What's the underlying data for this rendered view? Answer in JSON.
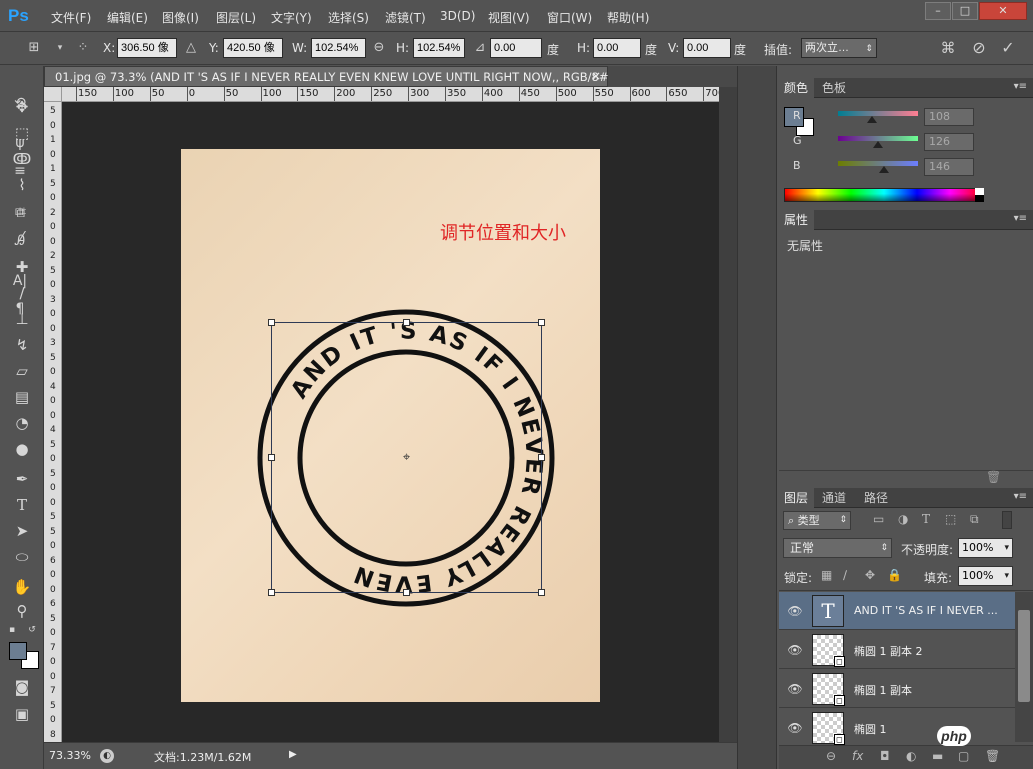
{
  "app": {
    "logo": "Ps"
  },
  "menu": [
    "文件(F)",
    "编辑(E)",
    "图像(I)",
    "图层(L)",
    "文字(Y)",
    "选择(S)",
    "滤镜(T)",
    "3D(D)",
    "视图(V)",
    "窗口(W)",
    "帮助(H)"
  ],
  "window_controls": {
    "minimize": "–",
    "maximize": "□",
    "close": "✕"
  },
  "options": {
    "x_label": "X:",
    "x_value": "306.50 像",
    "y_label": "Y:",
    "y_value": "420.50 像",
    "w_label": "W:",
    "w_value": "102.54%",
    "h_label": "H:",
    "h_value": "102.54%",
    "angle_value": "0.00",
    "angle_unit": "度",
    "hskew_label": "H:",
    "hskew_value": "0.00",
    "hskew_unit": "度",
    "vskew_label": "V:",
    "vskew_value": "0.00",
    "vskew_unit": "度",
    "interp_label": "插值:",
    "interp_value": "两次立…"
  },
  "document": {
    "tab_title": "01.jpg @ 73.3% (AND IT 'S  AS IF I NEVER REALLY EVEN KNEW LOVE UNTIL RIGHT NOW,, RGB/8#) *",
    "close": "×",
    "ruler_top_labels": [
      "150",
      "100",
      "50",
      "0",
      "50",
      "100",
      "150",
      "200",
      "250",
      "300",
      "350",
      "400",
      "450",
      "500",
      "550",
      "600",
      "650",
      "700"
    ],
    "ruler_left_labels": [
      "5",
      "0",
      "1",
      "0",
      "1",
      "5",
      "0",
      "2",
      "0",
      "0",
      "2",
      "5",
      "0",
      "3",
      "0",
      "0",
      "3",
      "5",
      "0",
      "4",
      "0",
      "0",
      "4",
      "5",
      "0",
      "5",
      "0",
      "0",
      "5",
      "5",
      "0",
      "6",
      "0",
      "0",
      "6",
      "5",
      "0",
      "7",
      "0",
      "0",
      "7",
      "5",
      "0",
      "8"
    ],
    "stamp_text": "AND IT 'S AS IF I NEVER REALLY EVEN",
    "annotation": "调节位置和大小",
    "paper_color": "#efd8ba",
    "ink_color": "#111111",
    "annotation_color": "#e02525"
  },
  "status": {
    "zoom": "73.33%",
    "doc_info": "文档:1.23M/1.62M"
  },
  "color_panel": {
    "tabs": [
      "颜色",
      "色板"
    ],
    "r_label": "R",
    "r_value": "108",
    "r_fraction": 0.424,
    "g_label": "G",
    "g_value": "126",
    "g_fraction": 0.494,
    "b_label": "B",
    "b_value": "146",
    "b_fraction": 0.573,
    "foreground": "#6c7e92",
    "background": "#ffffff"
  },
  "properties_panel": {
    "tab": "属性",
    "empty_text": "无属性"
  },
  "layers_panel": {
    "tabs": [
      "图层",
      "通道",
      "路径"
    ],
    "filter_label": "类型",
    "blend_mode": "正常",
    "opacity_label": "不透明度:",
    "opacity_value": "100%",
    "lock_label": "锁定:",
    "fill_label": "填充:",
    "fill_value": "100%",
    "layers": [
      {
        "name": "AND IT 'S  AS IF I NEVER ...",
        "kind": "text",
        "selected": true,
        "thumb_glyph": "T"
      },
      {
        "name": "椭圆 1 副本 2",
        "kind": "shape",
        "selected": false
      },
      {
        "name": "椭圆 1 副本",
        "kind": "shape",
        "selected": false
      },
      {
        "name": "椭圆 1",
        "kind": "shape",
        "selected": false
      }
    ]
  },
  "watermark": "php"
}
